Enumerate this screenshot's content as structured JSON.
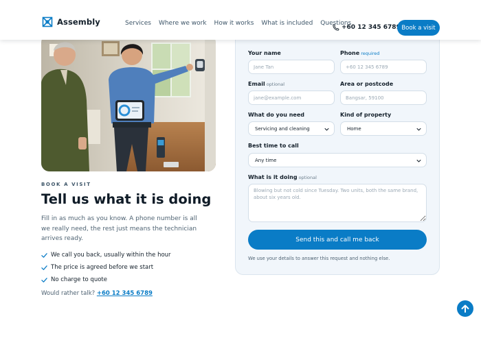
{
  "brand": {
    "name": "Assembly",
    "accent": "#0a7cc6"
  },
  "nav": {
    "items": [
      {
        "label": "Services"
      },
      {
        "label": "Where we work"
      },
      {
        "label": "How it works"
      },
      {
        "label": "What is included"
      },
      {
        "label": "Questions"
      }
    ],
    "phone": "+60 12 345 6789",
    "cta_label": "Book a visit"
  },
  "hero": {
    "image": "photo-technician-thermostat",
    "eyebrow": "BOOK A VISIT",
    "headline": "Tell us what it is doing",
    "intro": "Fill in as much as you know. A phone number is all we really need, the rest just means the technician arrives ready.",
    "checks": [
      "We call you back, usually within the hour",
      "The price is agreed before we start",
      "No charge to quote"
    ],
    "alt_contact_prefix": "Would rather talk?",
    "alt_contact_phone": "+60 12 345 6789"
  },
  "form": {
    "name": {
      "label": "Your name",
      "placeholder": "Jane Tan"
    },
    "phone": {
      "label": "Phone",
      "tag": "required",
      "placeholder": "+60 12 345 6789"
    },
    "email": {
      "label": "Email",
      "tag": "optional",
      "placeholder": "jane@example.com"
    },
    "area": {
      "label": "Area or postcode",
      "placeholder": "Bangsar, 59100"
    },
    "need": {
      "label": "What do you need",
      "value": "Servicing and cleaning"
    },
    "property": {
      "label": "Kind of property",
      "value": "Home"
    },
    "time": {
      "label": "Best time to call",
      "value": "Any time"
    },
    "issue": {
      "label": "What is it doing",
      "tag": "optional",
      "placeholder": "Blowing but not cold since Tuesday. Two units, both the same brand, about six years old."
    },
    "submit_label": "Send this and call me back",
    "privacy": "We use your details to answer this request and nothing else."
  }
}
